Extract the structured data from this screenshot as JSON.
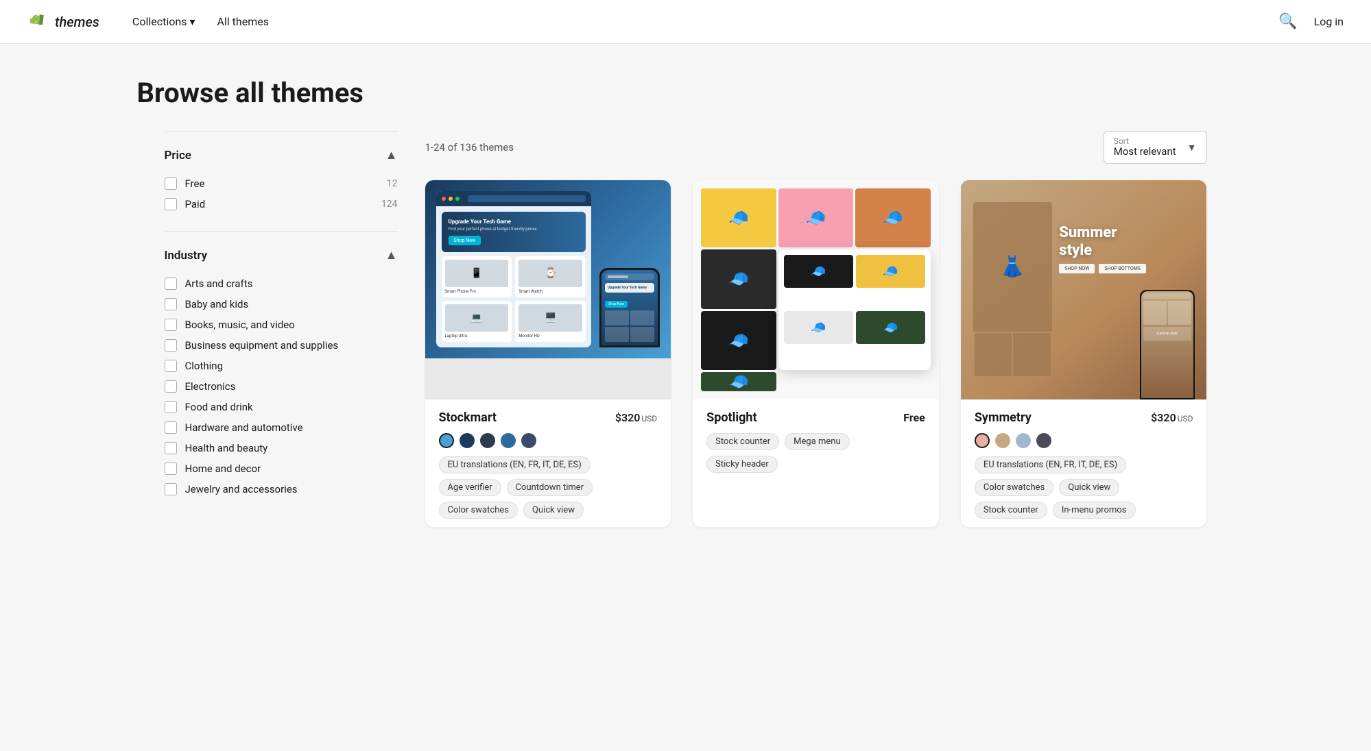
{
  "nav": {
    "logo_text": "themes",
    "collections_label": "Collections",
    "all_themes_label": "All themes",
    "login_label": "Log in"
  },
  "page": {
    "title": "Browse all themes"
  },
  "results": {
    "count_label": "1-24 of 136 themes",
    "sort_label": "Sort",
    "sort_value": "Most relevant"
  },
  "filters": {
    "price_title": "Price",
    "price_items": [
      {
        "label": "Free",
        "count": 12
      },
      {
        "label": "Paid",
        "count": 124
      }
    ],
    "industry_title": "Industry",
    "industry_items": [
      {
        "label": "Arts and crafts"
      },
      {
        "label": "Baby and kids"
      },
      {
        "label": "Books, music, and video"
      },
      {
        "label": "Business equipment and supplies"
      },
      {
        "label": "Clothing"
      },
      {
        "label": "Electronics"
      },
      {
        "label": "Food and drink"
      },
      {
        "label": "Hardware and automotive"
      },
      {
        "label": "Health and beauty"
      },
      {
        "label": "Home and decor"
      },
      {
        "label": "Jewelry and accessories"
      }
    ]
  },
  "themes": [
    {
      "name": "Stockmart",
      "price": "$320",
      "currency": "USD",
      "is_free": false,
      "swatches": [
        "#4a9fd4",
        "#1a3a5c",
        "#2d3b4e",
        "#2d6a9f",
        "#3a4a6a"
      ],
      "tags": [
        "EU translations (EN, FR, IT, DE, ES)",
        "Age verifier",
        "Countdown timer",
        "Color swatches",
        "Quick view"
      ]
    },
    {
      "name": "Spotlight",
      "price": "Free",
      "currency": "",
      "is_free": true,
      "swatches": [],
      "tags": [
        "Stock counter",
        "Mega menu",
        "Sticky header"
      ]
    },
    {
      "name": "Symmetry",
      "price": "$320",
      "currency": "USD",
      "is_free": false,
      "swatches": [
        "#e8b0a0",
        "#c4a882",
        "#a0b8d0",
        "#4a4a5a"
      ],
      "tags": [
        "EU translations (EN, FR, IT, DE, ES)",
        "Color swatches",
        "Quick view",
        "Stock counter",
        "In-menu promos"
      ]
    }
  ]
}
